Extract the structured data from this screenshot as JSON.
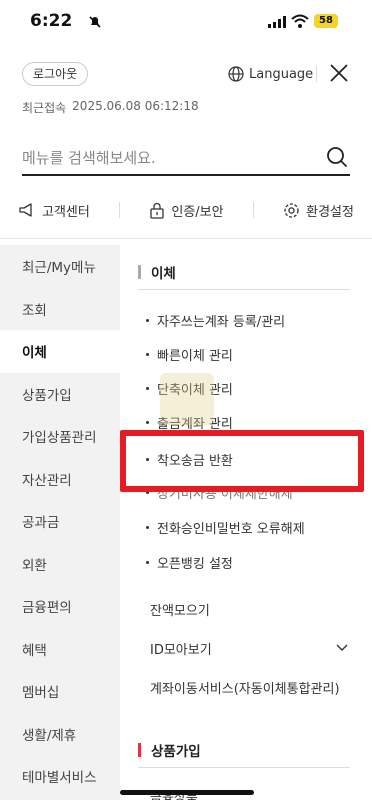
{
  "status": {
    "time": "6:22",
    "battery": "58"
  },
  "header": {
    "logout_label": "로그아웃",
    "language_label": "Language",
    "last_login_label": "최근접속",
    "last_login_value": "2025.06.08 06:12:18"
  },
  "search": {
    "placeholder": "메뉴를 검색해보세요."
  },
  "quick_links": [
    {
      "label": "고객센터",
      "icon": "megaphone-icon"
    },
    {
      "label": "인증/보안",
      "icon": "lock-icon"
    },
    {
      "label": "환경설정",
      "icon": "gear-icon"
    }
  ],
  "left_nav": {
    "items": [
      "최근/My메뉴",
      "조회",
      "이체",
      "상품가입",
      "가입상품관리",
      "자산관리",
      "공과금",
      "외환",
      "금융편의",
      "혜택",
      "멤버십",
      "생활/제휴",
      "테마별서비스"
    ],
    "active_index": 2
  },
  "right_panel": {
    "section1_title": "이체",
    "sub_items": [
      "자주쓰는계좌 등록/관리",
      "빠른이체 관리",
      "단축이체 관리",
      "출금계좌 관리",
      "착오송금 반환",
      "장기미사용 이체제한해제",
      "전화승인비밀번호 오류해제",
      "오픈뱅킹 설정"
    ],
    "plain_items": [
      "잔액모으기",
      "ID모아보기",
      "계좌이동서비스(자동이체통합관리)"
    ],
    "section2_title": "상품가입",
    "section2_partial": "금융상품"
  },
  "colors": {
    "accent": "#e3343d",
    "highlight": "#e51c23",
    "nav_bg": "#f2f2f2"
  }
}
